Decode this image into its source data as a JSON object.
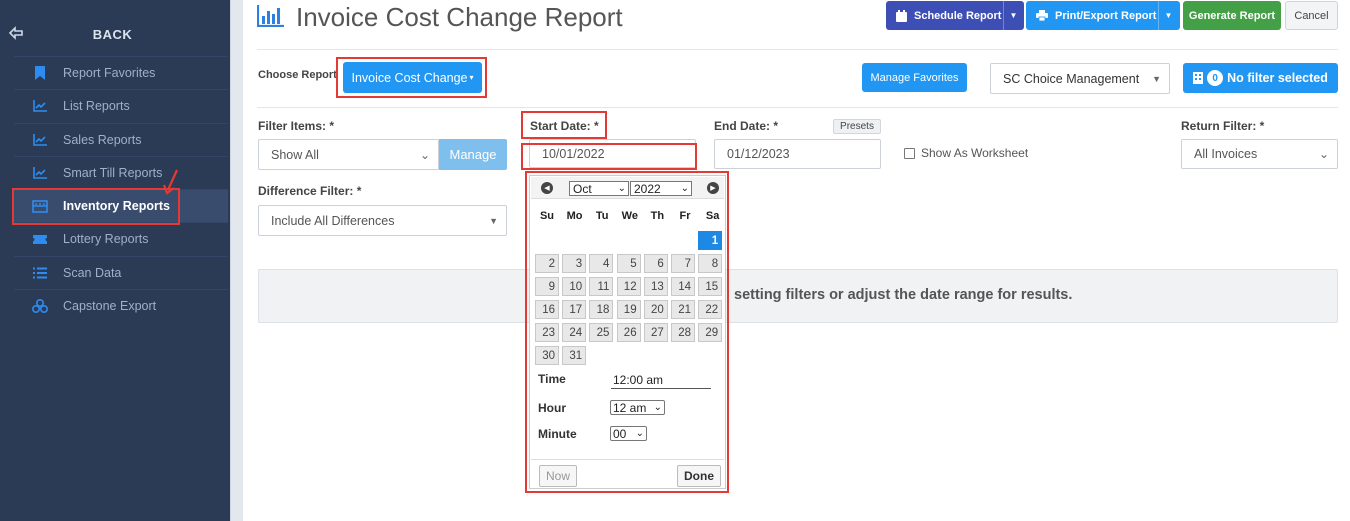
{
  "sidebar": {
    "back_label": "BACK",
    "items": [
      {
        "label": "Report Favorites",
        "icon": "bookmark-icon"
      },
      {
        "label": "List Reports",
        "icon": "line-chart-icon"
      },
      {
        "label": "Sales Reports",
        "icon": "line-chart-icon"
      },
      {
        "label": "Smart Till Reports",
        "icon": "line-chart-icon"
      },
      {
        "label": "Inventory Reports",
        "icon": "inventory-icon",
        "active": true
      },
      {
        "label": "Lottery Reports",
        "icon": "ticket-icon"
      },
      {
        "label": "Scan Data",
        "icon": "list-icon"
      },
      {
        "label": "Capstone Export",
        "icon": "cubes-icon"
      }
    ]
  },
  "header": {
    "title": "Invoice Cost Change Report",
    "schedule_label": "Schedule Report",
    "print_label": "Print/Export Report",
    "generate_label": "Generate Report",
    "cancel_label": "Cancel"
  },
  "report_bar": {
    "choose_label": "Choose Report",
    "report_button": "Invoice Cost Change",
    "manage_favorites": "Manage Favorites",
    "store_select": "SC Choice Management",
    "filter_count": "0",
    "filter_label": "No filter selected"
  },
  "filters": {
    "filter_items_label": "Filter Items: *",
    "filter_items_value": "Show All",
    "manage_label": "Manage",
    "start_date_label": "Start Date: *",
    "start_date_value": "10/01/2022",
    "end_date_label": "End Date: *",
    "presets_label": "Presets",
    "end_date_value": "01/12/2023",
    "worksheet_label": "Show As Worksheet",
    "return_filter_label": "Return Filter: *",
    "return_filter_value": "All Invoices",
    "difference_filter_label": "Difference Filter: *",
    "difference_filter_value": "Include All Differences"
  },
  "info": {
    "message": "setting filters or adjust the date range for results."
  },
  "calendar": {
    "month": "Oct",
    "year": "2022",
    "weekdays": [
      "Su",
      "Mo",
      "Tu",
      "We",
      "Th",
      "Fr",
      "Sa"
    ],
    "days": [
      "1",
      "2",
      "3",
      "4",
      "5",
      "6",
      "7",
      "8",
      "9",
      "10",
      "11",
      "12",
      "13",
      "14",
      "15",
      "16",
      "17",
      "18",
      "19",
      "20",
      "21",
      "22",
      "23",
      "24",
      "25",
      "26",
      "27",
      "28",
      "29",
      "30",
      "31"
    ],
    "selected_day": "1",
    "time_label": "Time",
    "time_value": "12:00 am",
    "hour_label": "Hour",
    "hour_value": "12 am",
    "minute_label": "Minute",
    "minute_value": "00",
    "now_label": "Now",
    "done_label": "Done"
  },
  "colors": {
    "sidebar_bg": "#2b3a55",
    "accent_blue": "#2196f3",
    "highlight_red": "#e53935",
    "generate_green": "#43a047",
    "schedule_purple": "#3d4fb5"
  }
}
